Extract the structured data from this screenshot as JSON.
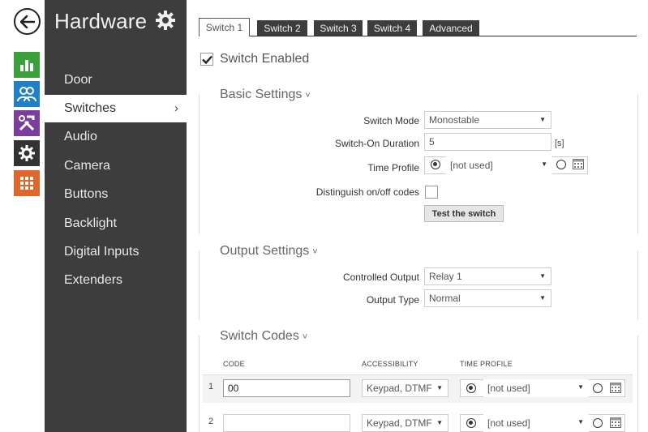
{
  "sidebar": {
    "title": "Hardware",
    "items": [
      {
        "label": "Door"
      },
      {
        "label": "Switches",
        "chevron": "›"
      },
      {
        "label": "Audio"
      },
      {
        "label": "Camera"
      },
      {
        "label": "Buttons"
      },
      {
        "label": "Backlight"
      },
      {
        "label": "Digital Inputs"
      },
      {
        "label": "Extenders"
      }
    ]
  },
  "rail": {
    "icons": [
      "status-icon",
      "users-icon",
      "services-icon",
      "hardware-icon",
      "system-icon"
    ],
    "colors": [
      "#3aa03a",
      "#1f7fc8",
      "#7a3e9e",
      "#333333",
      "#e0662a"
    ]
  },
  "tabs": [
    "Switch 1",
    "Switch 2",
    "Switch 3",
    "Switch 4",
    "Advanced"
  ],
  "switch_enabled": {
    "label": "Switch Enabled",
    "checked": true
  },
  "basic": {
    "title": "Basic Settings",
    "caret": "˅",
    "mode_label": "Switch Mode",
    "mode_value": "Monostable",
    "duration_label": "Switch-On Duration",
    "duration_value": "5",
    "duration_unit": "[s]",
    "profile_label": "Time Profile",
    "profile_value": "[not used]",
    "distinguish_label": "Distinguish on/off codes",
    "test_button": "Test the switch"
  },
  "output": {
    "title": "Output Settings",
    "caret": "˅",
    "controlled_label": "Controlled Output",
    "controlled_value": "Relay 1",
    "type_label": "Output Type",
    "type_value": "Normal"
  },
  "codes": {
    "title": "Switch Codes",
    "caret": "˅",
    "headers": [
      "CODE",
      "ACCESSIBILITY",
      "TIME PROFILE"
    ],
    "rows": [
      {
        "num": "1",
        "code": "00",
        "access": "Keypad, DTMF",
        "profile": "[not used]"
      },
      {
        "num": "2",
        "code": "",
        "access": "Keypad, DTMF",
        "profile": "[not used]"
      }
    ]
  }
}
